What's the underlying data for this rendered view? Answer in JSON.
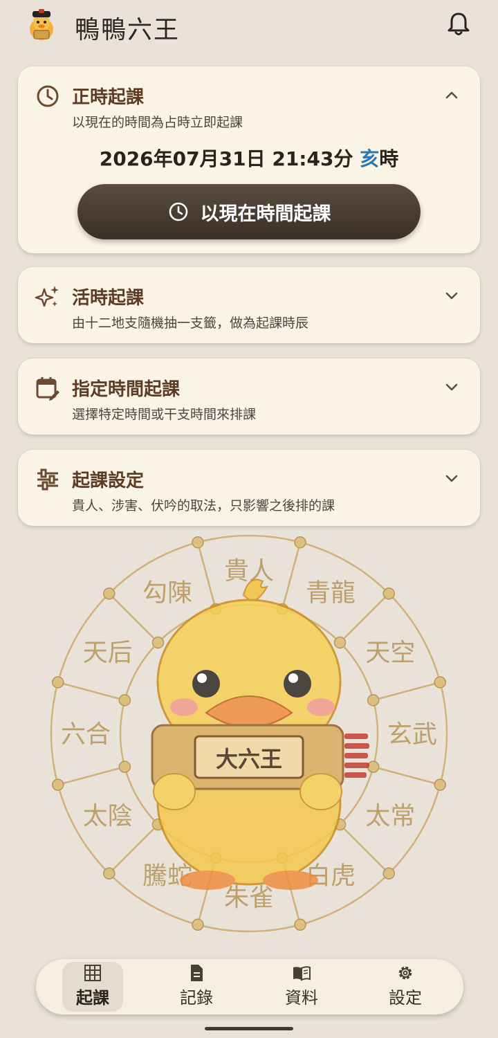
{
  "header": {
    "app_title": "鴨鴨六王",
    "logo_icon": "duck-official-icon",
    "bell_icon": "bell-icon"
  },
  "cards": {
    "now": {
      "title": "正時起課",
      "subtitle": "以現在的時間為占時立即起課",
      "datetime": "2026年07月31日 21:43分",
      "hour_branch": "亥",
      "hour_suffix": "時",
      "button_label": "以現在時間起課",
      "icon": "clock-icon",
      "expanded": true
    },
    "live": {
      "title": "活時起課",
      "subtitle": "由十二地支隨機抽一支籤，做為起課時辰",
      "icon": "sparkle-icon"
    },
    "specified": {
      "title": "指定時間起課",
      "subtitle": "選擇特定時間或干支時間來排課",
      "icon": "calendar-edit-icon"
    },
    "settings": {
      "title": "起課設定",
      "subtitle": "貴人、涉害、伏吟的取法，只影響之後排的課",
      "icon": "sliders-icon"
    }
  },
  "wheel": {
    "generals": [
      "貴人",
      "青龍",
      "天空",
      "玄武",
      "太常",
      "白虎",
      "朱雀",
      "騰蛇",
      "太陰",
      "六合",
      "天后",
      "勾陳"
    ],
    "scroll_label": "大六王"
  },
  "nav": {
    "items": [
      {
        "label": "起課",
        "icon": "grid-icon",
        "active": true
      },
      {
        "label": "記錄",
        "icon": "document-icon",
        "active": false
      },
      {
        "label": "資料",
        "icon": "book-icon",
        "active": false
      },
      {
        "label": "設定",
        "icon": "gear-icon",
        "active": false
      }
    ]
  },
  "colors": {
    "background": "#e8e2d9",
    "card": "#faf4e6",
    "title_brown": "#5c3c25",
    "button_dark": "#3b3028",
    "hour_blue": "#2a78b4",
    "gold": "#c9a35a"
  }
}
